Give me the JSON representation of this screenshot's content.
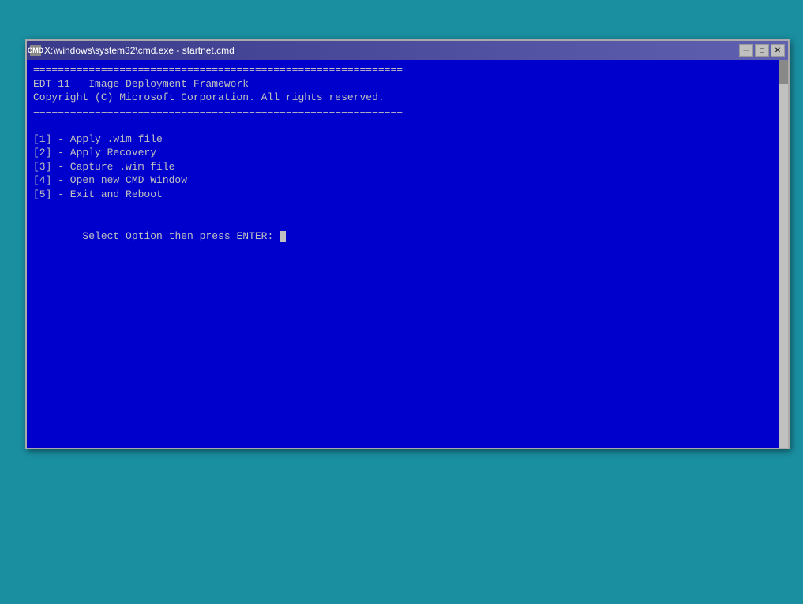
{
  "desktop": {
    "background_color": "#1a8fa0"
  },
  "window": {
    "title": "X:\\windows\\system32\\cmd.exe - startnet.cmd",
    "title_icon": "CMD",
    "minimize_label": "─",
    "maximize_label": "□",
    "close_label": "✕"
  },
  "console": {
    "separator": "============================================================",
    "line1": "EDT 11 - Image Deployment Framework",
    "line2": "Copyright (C) Microsoft Corporation. All rights reserved.",
    "menu_item_1": "[1] - Apply .wim file",
    "menu_item_2": "[2] - Apply Recovery",
    "menu_item_3": "[3] - Capture .wim file",
    "menu_item_4": "[4] - Open new CMD Window",
    "menu_item_5": "[5] - Exit and Reboot",
    "prompt": "Select Option then press ENTER: "
  }
}
